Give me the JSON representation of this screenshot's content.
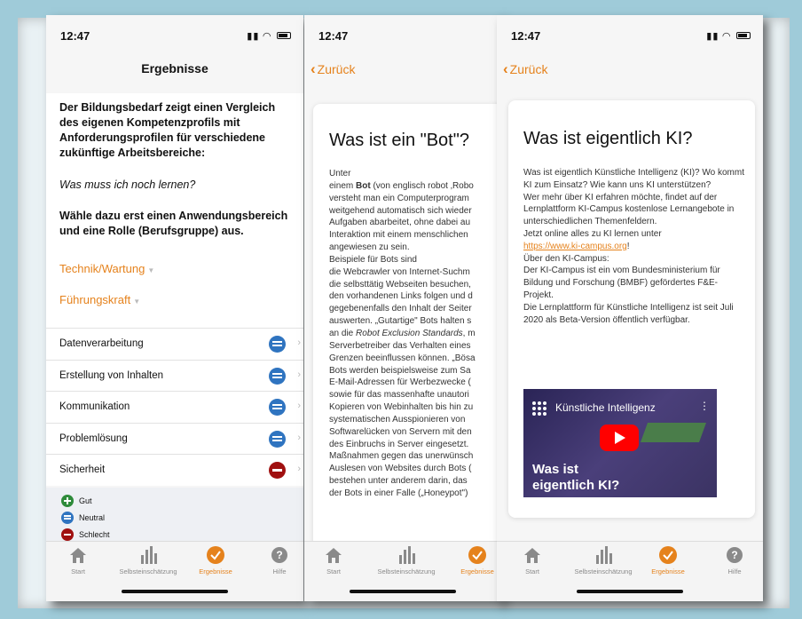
{
  "colors": {
    "accent": "#e5821c",
    "neutral": "#2f74c0",
    "good": "#2e8b3a",
    "bad": "#a01010",
    "frame": "#9fcbd9"
  },
  "status_bar": {
    "time": "12:47",
    "signal_icon": "signal-icon",
    "wifi_icon": "wifi-icon",
    "battery_icon": "battery-icon"
  },
  "screen1": {
    "title": "Ergebnisse",
    "intro_bold": "Der Bildungsbedarf zeigt einen Vergleich des eigenen Kompetenzprofils mit Anforderungsprofilen für verschiedene zukünftige Arbeitsbereiche:",
    "question": "Was muss ich noch lernen?",
    "instruction": "Wähle dazu erst einen Anwendungsbereich und eine Rolle (Berufsgruppe) aus.",
    "dropdown_area": "Technik/Wartung",
    "dropdown_role": "Führungskraft",
    "items": [
      {
        "label": "Datenverarbeitung",
        "status": "neutral"
      },
      {
        "label": "Erstellung von Inhalten",
        "status": "neutral"
      },
      {
        "label": "Kommunikation",
        "status": "neutral"
      },
      {
        "label": "Problemlösung",
        "status": "neutral"
      },
      {
        "label": "Sicherheit",
        "status": "bad"
      }
    ],
    "legend": {
      "good": "Gut",
      "neutral": "Neutral",
      "bad": "Schlecht"
    }
  },
  "tabs": {
    "start": "Start",
    "self": "Selbsteinschätzung",
    "results": "Ergebnisse",
    "help": "Hilfe"
  },
  "screen2": {
    "back": "Zurück",
    "title": "Was ist ein \"Bot\"?",
    "lines": [
      "Unter",
      "einem Bot (von englisch robot ‚Robo",
      "versteht man ein Computerprogram",
      "weitgehend automatisch sich wieder",
      "Aufgaben abarbeitet, ohne dabei au",
      "Interaktion mit einem menschlichen",
      "angewiesen zu sein.",
      "Beispiele für Bots sind",
      "die Webcrawler von Internet-Suchm",
      "die selbsttätig Webseiten besuchen,",
      "den vorhandenen Links folgen und d",
      "gegebenenfalls den Inhalt der Seiter",
      "auswerten. „Gutartige\" Bots halten s",
      "an die Robot Exclusion Standards, m",
      "Serverbetreiber das Verhalten eines",
      "Grenzen beeinflussen können. „Bösa",
      "Bots werden beispielsweise zum Sa",
      "E-Mail-Adressen für Werbezwecke (",
      "sowie für das massenhafte unautori",
      "Kopieren von Webinhalten bis hin zu",
      "systematischen Ausspionieren von",
      "Softwarelücken von Servern mit den",
      "des Einbruchs in Server eingesetzt.",
      "Maßnahmen gegen das unerwünsch",
      "Auslesen von Websites durch Bots (",
      "bestehen unter anderem darin, das",
      "der Bots in einer Falle („Honeypot\")"
    ]
  },
  "screen3": {
    "back": "Zurück",
    "title": "Was ist eigentlich KI?",
    "p1": "Was ist eigentlich Künstliche Intelligenz (KI)? Wo kommt KI zum Einsatz? Wie kann uns KI unterstützen?",
    "p2": "Wer mehr über KI erfahren möchte, findet auf der Lernplattform KI-Campus kostenlose Lernangebote in unterschiedlichen Themenfeldern.",
    "p3": "Jetzt online alles zu KI lernen unter",
    "url": "https://www.ki-campus.org",
    "p3_end": "!",
    "p4": "Über den KI-Campus:",
    "p5": "Der KI-Campus ist ein vom Bundesministerium für Bildung und Forschung (BMBF) gefördertes F&E-Projekt.",
    "p6": "Die Lernplattform für Künstliche Intelligenz ist seit Juli 2020 als Beta-Version öffentlich verfügbar.",
    "video_title": "Künstliche Intelligenz",
    "video_caption": "Was ist eigentlich KI?"
  }
}
